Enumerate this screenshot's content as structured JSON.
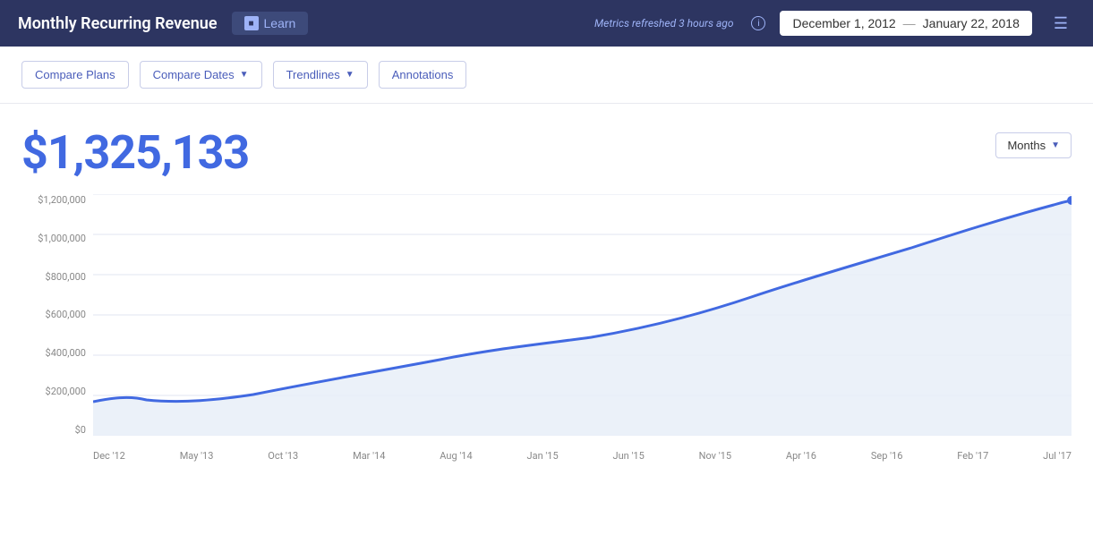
{
  "header": {
    "title": "Monthly Recurring Revenue",
    "learn_label": "Learn",
    "metrics_refreshed": "Metrics refreshed 3 hours ago",
    "date_start": "December 1, 2012",
    "date_end": "January 22, 2018",
    "date_separator": "—"
  },
  "toolbar": {
    "compare_plans": "Compare Plans",
    "compare_dates": "Compare Dates",
    "trendlines": "Trendlines",
    "annotations": "Annotations"
  },
  "metric": {
    "value": "$1,325,133",
    "period_label": "Months"
  },
  "chart": {
    "y_labels": [
      "$0",
      "$200,000",
      "$400,000",
      "$600,000",
      "$800,000",
      "$1,000,000",
      "$1,200,000"
    ],
    "x_labels": [
      "Dec '12",
      "May '13",
      "Oct '13",
      "Mar '14",
      "Aug '14",
      "Jan '15",
      "Jun '15",
      "Nov '15",
      "Apr '16",
      "Sep '16",
      "Feb '17",
      "Jul '17"
    ],
    "accent_color": "#4169e1",
    "fill_color": "#e8eef8"
  }
}
